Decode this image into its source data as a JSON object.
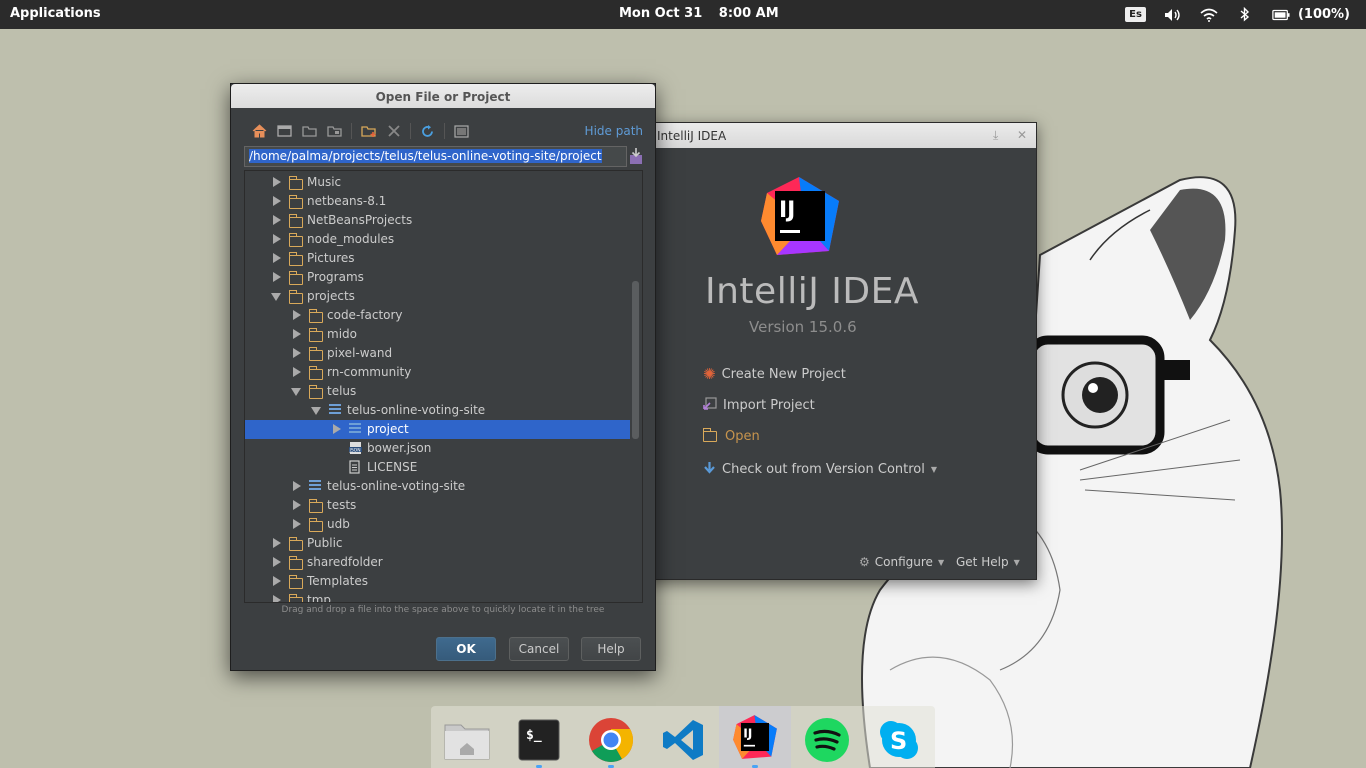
{
  "topbar": {
    "applications": "Applications",
    "date": "Mon Oct 31",
    "time": "8:00 AM",
    "keyboard_layout": "Es",
    "battery": "(100%)",
    "icons": [
      "volume-icon",
      "wifi-icon",
      "bluetooth-icon",
      "battery-icon"
    ]
  },
  "ij_window": {
    "title": "IntelliJ IDEA",
    "product_name": "IntelliJ IDEA",
    "version": "Version 15.0.6",
    "actions": {
      "create": "Create New Project",
      "import": "Import Project",
      "open": "Open",
      "checkout": "Check out from Version Control"
    },
    "footer": {
      "configure": "Configure",
      "help": "Get Help"
    }
  },
  "dialog": {
    "title": "Open File or Project",
    "hide_path": "Hide path",
    "path": "/home/palma/projects/telus/telus-online-voting-site/project",
    "tree": [
      {
        "label": "Music",
        "kind": "folder",
        "expander": "collapsed",
        "depth": 0
      },
      {
        "label": "netbeans-8.1",
        "kind": "folder",
        "expander": "collapsed",
        "depth": 0
      },
      {
        "label": "NetBeansProjects",
        "kind": "folder",
        "expander": "collapsed",
        "depth": 0
      },
      {
        "label": "node_modules",
        "kind": "folder",
        "expander": "collapsed",
        "depth": 0
      },
      {
        "label": "Pictures",
        "kind": "folder",
        "expander": "collapsed",
        "depth": 0
      },
      {
        "label": "Programs",
        "kind": "folder",
        "expander": "collapsed",
        "depth": 0
      },
      {
        "label": "projects",
        "kind": "folder",
        "expander": "expanded",
        "depth": 0
      },
      {
        "label": "code-factory",
        "kind": "folder",
        "expander": "collapsed",
        "depth": 1
      },
      {
        "label": "mido",
        "kind": "folder",
        "expander": "collapsed",
        "depth": 1
      },
      {
        "label": "pixel-wand",
        "kind": "folder",
        "expander": "collapsed",
        "depth": 1
      },
      {
        "label": "rn-community",
        "kind": "folder",
        "expander": "collapsed",
        "depth": 1
      },
      {
        "label": "telus",
        "kind": "folder",
        "expander": "expanded",
        "depth": 1
      },
      {
        "label": "telus-online-voting-site",
        "kind": "module",
        "expander": "expanded",
        "depth": 2
      },
      {
        "label": "project",
        "kind": "module",
        "expander": "collapsed",
        "depth": 3,
        "selected": true
      },
      {
        "label": "bower.json",
        "kind": "json",
        "expander": "none",
        "depth": 3
      },
      {
        "label": "LICENSE",
        "kind": "file",
        "expander": "none",
        "depth": 3
      },
      {
        "label": "telus-online-voting-site",
        "kind": "module",
        "expander": "collapsed",
        "depth": 1
      },
      {
        "label": "tests",
        "kind": "folder",
        "expander": "collapsed",
        "depth": 1
      },
      {
        "label": "udb",
        "kind": "folder",
        "expander": "collapsed",
        "depth": 1
      },
      {
        "label": "Public",
        "kind": "folder",
        "expander": "collapsed",
        "depth": 0
      },
      {
        "label": "sharedfolder",
        "kind": "folder",
        "expander": "collapsed",
        "depth": 0
      },
      {
        "label": "Templates",
        "kind": "folder",
        "expander": "collapsed",
        "depth": 0
      },
      {
        "label": "tmp",
        "kind": "folder",
        "expander": "collapsed",
        "depth": 0
      }
    ],
    "hint": "Drag and drop a file into the space above to quickly locate it in the tree",
    "buttons": {
      "ok": "OK",
      "cancel": "Cancel",
      "help": "Help"
    }
  },
  "dock": {
    "items": [
      "home-folder",
      "terminal",
      "chrome",
      "vscode",
      "intellij",
      "spotify",
      "skype"
    ],
    "active": "intellij"
  },
  "colors": {
    "accent_blue": "#2f65ca",
    "panel": "#2b2b2b",
    "dialog_bg": "#3c3f41",
    "folder": "#d9a95a",
    "link": "#5f9bd6",
    "open_orange": "#c7944d"
  }
}
